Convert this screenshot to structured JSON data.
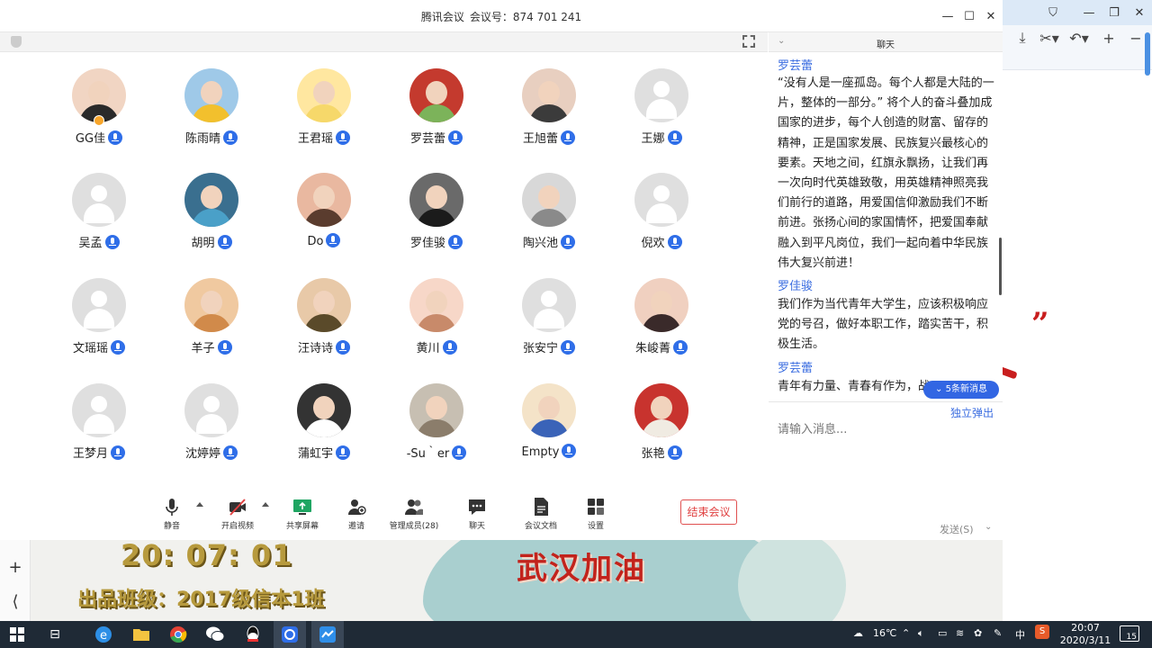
{
  "meeting": {
    "title_app": "腾讯会议",
    "title_id_label": "会议号：",
    "title_id": "874 701 241"
  },
  "participants": [
    {
      "name": "GG佳",
      "avatar": "photo",
      "host": true
    },
    {
      "name": "陈雨晴",
      "avatar": "photo"
    },
    {
      "name": "王君瑶",
      "avatar": "photo"
    },
    {
      "name": "罗芸蕾",
      "avatar": "photo"
    },
    {
      "name": "王旭蕾",
      "avatar": "photo"
    },
    {
      "name": "王娜",
      "avatar": "default"
    },
    {
      "name": "吴孟",
      "avatar": "default"
    },
    {
      "name": "胡明",
      "avatar": "photo"
    },
    {
      "name": "Do",
      "avatar": "photo"
    },
    {
      "name": "罗佳骏",
      "avatar": "photo"
    },
    {
      "name": "陶兴池",
      "avatar": "photo"
    },
    {
      "name": "倪欢",
      "avatar": "default"
    },
    {
      "name": "文瑶瑶",
      "avatar": "default"
    },
    {
      "name": "羊子",
      "avatar": "photo"
    },
    {
      "name": "汪诗诗",
      "avatar": "photo"
    },
    {
      "name": "黄川",
      "avatar": "photo"
    },
    {
      "name": "张安宁",
      "avatar": "default"
    },
    {
      "name": "朱峻菁",
      "avatar": "photo"
    },
    {
      "name": "王梦月",
      "avatar": "default"
    },
    {
      "name": "沈婷婷",
      "avatar": "default"
    },
    {
      "name": "蒲虹宇",
      "avatar": "photo"
    },
    {
      "name": "-Su｀er",
      "avatar": "photo"
    },
    {
      "name": "Empty",
      "avatar": "photo"
    },
    {
      "name": "张艳",
      "avatar": "photo"
    }
  ],
  "toolbar": {
    "mute": "静音",
    "video": "开启视频",
    "share": "共享屏幕",
    "invite": "邀请",
    "members": "管理成员(28)",
    "chat": "聊天",
    "docs": "会议文档",
    "settings": "设置",
    "end": "结束会议"
  },
  "chat": {
    "title": "聊天",
    "messages": [
      {
        "sender": "罗芸蕾",
        "text": "“没有人是一座孤岛。每个人都是大陆的一片，整体的一部分。” 将个人的奋斗叠加成国家的进步，每个人创造的财富、留存的精神，正是国家发展、民族复兴最核心的要素。天地之间，红旗永飘扬，让我们再一次向时代英雄致敬，用英雄精神照亮我们前行的道路，用爱国信仰激励我们不断前进。张扬心间的家国情怀，把爱国奉献融入到平凡岗位，我们一起向着中华民族伟大复兴前进！"
      },
      {
        "sender": "罗佳骏",
        "text": "我们作为当代青年大学生，应该积极响应党的号召，做好本职工作，踏实苦干，积极生活。"
      },
      {
        "sender": "罗芸蕾",
        "text": "青年有力量、青春有作为，战"
      }
    ],
    "new_messages": "5条新消息",
    "popout": "独立弹出",
    "input_placeholder": "请输入消息...",
    "send": "发送(S)"
  },
  "stage": {
    "clock": "20: 07: 01",
    "class_line": "出品班级：2017级信本1班",
    "slogan": "武汉加油",
    "quote_mark": "”"
  },
  "taskbar": {
    "temperature": "16℃",
    "ime": "中",
    "time": "20:07",
    "date": "2020/3/11",
    "notifications": "15"
  },
  "colors": {
    "accent": "#2f6ee8",
    "end_button": "#e04040",
    "clock_gold": "#b79a3d",
    "slogan_red": "#c2231c"
  }
}
